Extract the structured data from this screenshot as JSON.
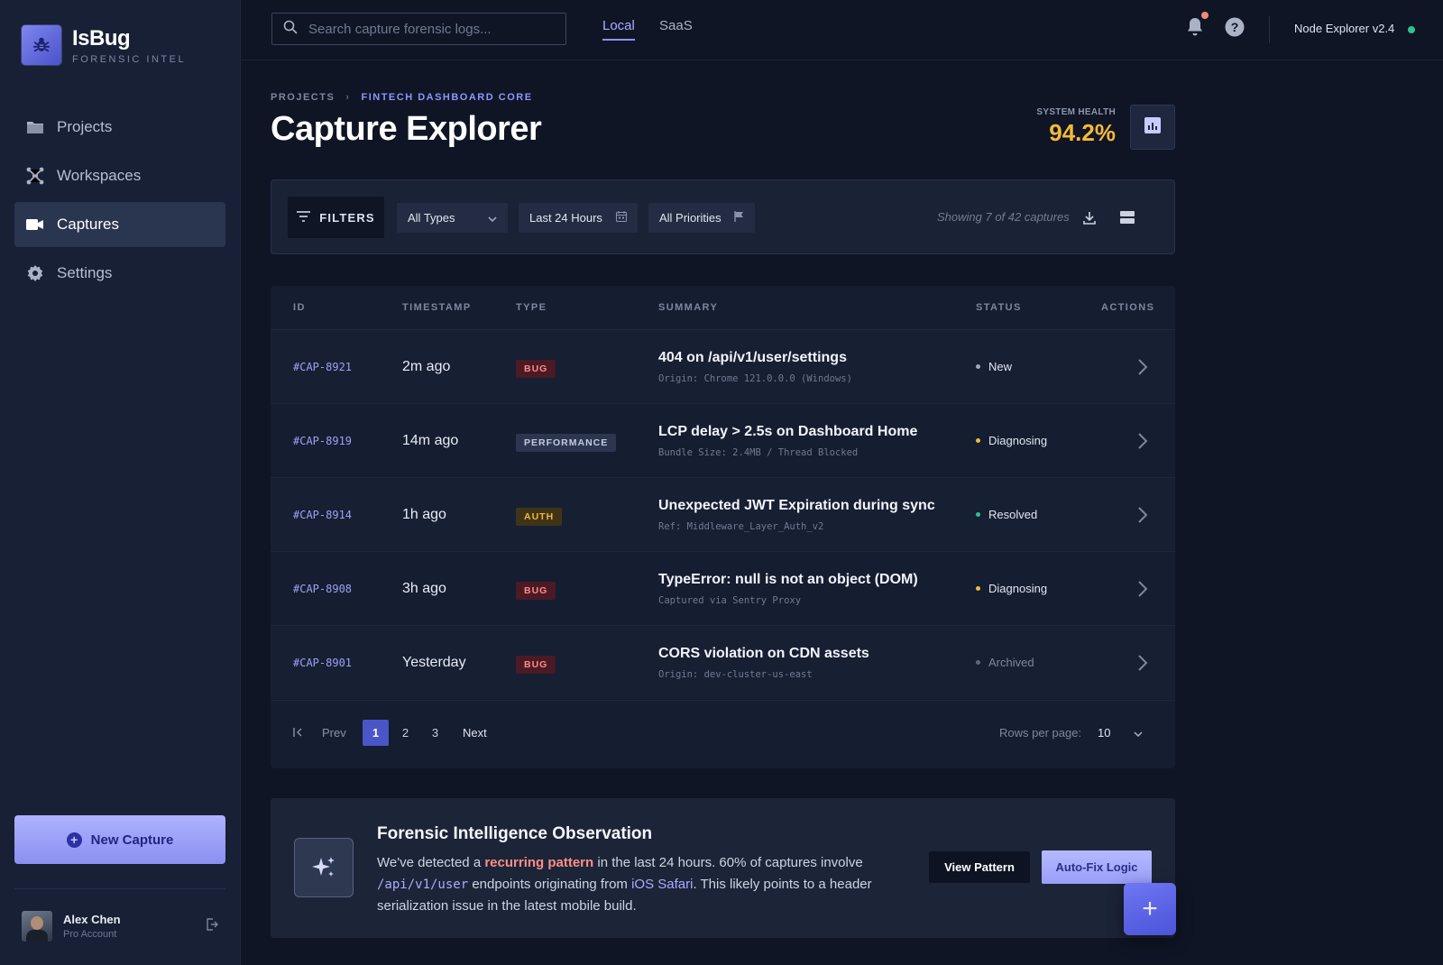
{
  "brand": {
    "name": "IsBug",
    "subtitle": "FORENSIC INTEL"
  },
  "sidebar": {
    "items": [
      {
        "label": "Projects",
        "icon": "folder-icon"
      },
      {
        "label": "Workspaces",
        "icon": "hub-icon"
      },
      {
        "label": "Captures",
        "icon": "video-icon",
        "active": true
      },
      {
        "label": "Settings",
        "icon": "gear-icon"
      }
    ],
    "new_capture_label": "New Capture",
    "user": {
      "name": "Alex Chen",
      "role": "Pro Account"
    }
  },
  "topbar": {
    "search_placeholder": "Search capture forensic logs...",
    "tabs": [
      {
        "label": "Local",
        "active": true
      },
      {
        "label": "SaaS",
        "active": false
      }
    ],
    "node_label": "Node Explorer v2.4",
    "node_status_color": "#2bc48a"
  },
  "page": {
    "breadcrumb": {
      "root": "PROJECTS",
      "current": "FINTECH DASHBOARD CORE"
    },
    "title": "Capture Explorer",
    "health": {
      "label": "SYSTEM HEALTH",
      "value": "94.2%"
    }
  },
  "filters": {
    "button_label": "FILTERS",
    "type_select": "All Types",
    "time_range": "Last 24 Hours",
    "priority": "All Priorities",
    "showing": "Showing 7 of 42 captures"
  },
  "table": {
    "headers": {
      "id": "ID",
      "timestamp": "TIMESTAMP",
      "type": "TYPE",
      "summary": "SUMMARY",
      "status": "STATUS",
      "actions": "ACTIONS"
    },
    "rows": [
      {
        "id": "#CAP-8921",
        "time": "2m ago",
        "type": "BUG",
        "title": "404 on /api/v1/user/settings",
        "sub": "Origin: Chrome 121.0.0.0 (Windows)",
        "status": "New"
      },
      {
        "id": "#CAP-8919",
        "time": "14m ago",
        "type": "PERFORMANCE",
        "title": "LCP delay > 2.5s on Dashboard Home",
        "sub": "Bundle Size: 2.4MB / Thread Blocked",
        "status": "Diagnosing"
      },
      {
        "id": "#CAP-8914",
        "time": "1h ago",
        "type": "AUTH",
        "title": "Unexpected JWT Expiration during sync",
        "sub": "Ref: Middleware_Layer_Auth_v2",
        "status": "Resolved"
      },
      {
        "id": "#CAP-8908",
        "time": "3h ago",
        "type": "BUG",
        "title": "TypeError: null is not an object (DOM)",
        "sub": "Captured via Sentry Proxy",
        "status": "Diagnosing"
      },
      {
        "id": "#CAP-8901",
        "time": "Yesterday",
        "type": "BUG",
        "title": "CORS violation on CDN assets",
        "sub": "Origin: dev-cluster-us-east",
        "status": "Archived"
      }
    ],
    "status_colors": {
      "New": "#a1a9bb",
      "Diagnosing": "#f5b938",
      "Resolved": "#2bc48a",
      "Archived": "#5e6880"
    }
  },
  "pagination": {
    "prev": "Prev",
    "next": "Next",
    "pages": [
      "1",
      "2",
      "3"
    ],
    "current": "1",
    "rows_per_page_label": "Rows per page:",
    "rows_per_page": "10"
  },
  "insight": {
    "title": "Forensic Intelligence Observation",
    "text_1": "We've detected a ",
    "highlight": "recurring pattern",
    "text_2": " in the last 24 hours. 60% of captures involve ",
    "endpoint": "/api/v1/user",
    "text_3": " endpoints originating from ",
    "platform": "iOS Safari",
    "text_4": ". This likely points to a header serialization issue in the latest mobile build.",
    "view_label": "View Pattern",
    "autofix_label": "Auto-Fix Logic"
  },
  "fab_label": "+"
}
